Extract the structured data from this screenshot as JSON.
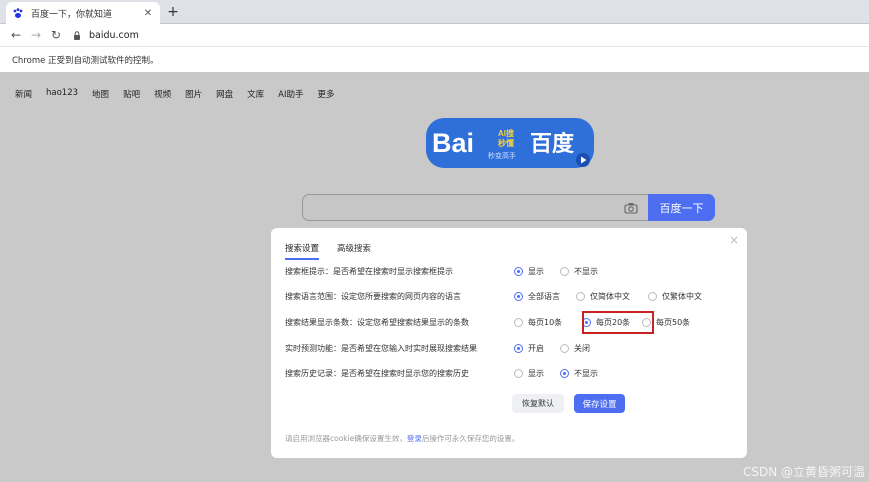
{
  "browser": {
    "tab_title": "百度一下，你就知道",
    "new_tab": "+",
    "close_tab": "✕",
    "url": "baidu.com",
    "infobar_text": "Chrome 正受到自动测试软件的控制。"
  },
  "topnav": [
    "新闻",
    "hao123",
    "地图",
    "贴吧",
    "视频",
    "图片",
    "网盘",
    "文库",
    "AI助手",
    "更多"
  ],
  "logo": {
    "text_bai": "Bai",
    "text_baidu": "百度",
    "badge_line1": "AI搜",
    "badge_line2": "秒懂",
    "badge_line3": "秒变高手"
  },
  "search": {
    "button": "百度一下"
  },
  "dialog": {
    "tabs": [
      "搜索设置",
      "高级搜索"
    ],
    "close": "×",
    "rows": [
      {
        "label": "搜索框提示：是否希望在搜索时显示搜索框提示",
        "options": [
          {
            "text": "显示",
            "selected": true
          },
          {
            "text": "不显示",
            "selected": false
          }
        ]
      },
      {
        "label": "搜索语言范围：设定您所要搜索的网页内容的语言",
        "options": [
          {
            "text": "全部语言",
            "selected": true
          },
          {
            "text": "仅简体中文",
            "selected": false
          },
          {
            "text": "仅繁体中文",
            "selected": false
          }
        ]
      },
      {
        "label": "搜索结果显示条数：设定您希望搜索结果显示的条数",
        "options": [
          {
            "text": "每页10条",
            "selected": false
          },
          {
            "text": "每页20条",
            "selected": true
          },
          {
            "text": "每页50条",
            "selected": false
          }
        ]
      },
      {
        "label": "实时预测功能：是否希望在您输入时实时展现搜索结果",
        "options": [
          {
            "text": "开启",
            "selected": true
          },
          {
            "text": "关闭",
            "selected": false
          }
        ]
      },
      {
        "label": "搜索历史记录：是否希望在搜索时显示您的搜索历史",
        "options": [
          {
            "text": "显示",
            "selected": false
          },
          {
            "text": "不显示",
            "selected": true
          }
        ]
      }
    ],
    "restore_button": "恢复默认",
    "save_button": "保存设置",
    "footnote_pre": "请启用浏览器cookie确保设置生效，",
    "footnote_link": "登录",
    "footnote_post": "后操作可永久保存您的设置。"
  },
  "watermark": "CSDN @立黄昏粥可温",
  "colors": {
    "accent": "#4e6ef2",
    "highlight": "#c82323",
    "overlay": "#c9c9c9"
  }
}
